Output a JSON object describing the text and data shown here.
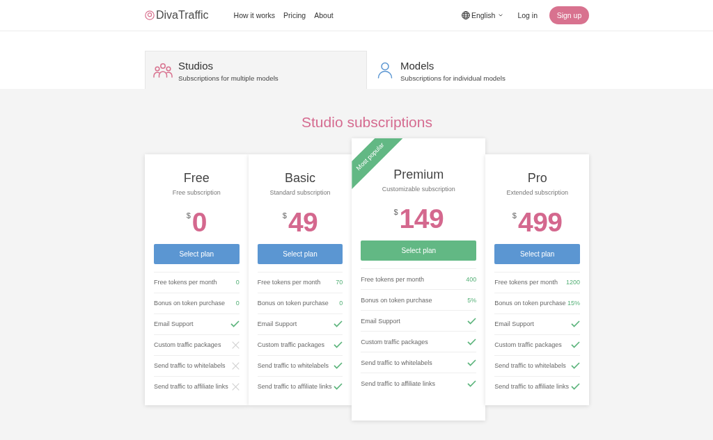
{
  "header": {
    "logo": "DivaTraffic",
    "nav": [
      "How it works",
      "Pricing",
      "About"
    ],
    "language": "English",
    "login": "Log in",
    "signup": "Sign up"
  },
  "tabs": [
    {
      "title": "Studios",
      "subtitle": "Subscriptions for multiple models",
      "selected": true
    },
    {
      "title": "Models",
      "subtitle": "Subscriptions for individual models",
      "selected": false
    }
  ],
  "heading": "Studio subscriptions",
  "plans": [
    {
      "name": "Free",
      "subtitle": "Free subscription",
      "currency": "$",
      "price": "0",
      "button": "Select plan",
      "featured": false,
      "features": [
        {
          "label": "Free tokens per month",
          "kind": "value",
          "value": "0"
        },
        {
          "label": "Bonus on token purchase",
          "kind": "value",
          "value": "0"
        },
        {
          "label": "Email Support",
          "kind": "check",
          "included": true
        },
        {
          "label": "Custom traffic packages",
          "kind": "check",
          "included": false
        },
        {
          "label": "Send traffic to whitelabels",
          "kind": "check",
          "included": false
        },
        {
          "label": "Send traffic to affiliate links",
          "kind": "check",
          "included": false
        }
      ]
    },
    {
      "name": "Basic",
      "subtitle": "Standard subscription",
      "currency": "$",
      "price": "49",
      "button": "Select plan",
      "featured": false,
      "features": [
        {
          "label": "Free tokens per month",
          "kind": "value",
          "value": "70"
        },
        {
          "label": "Bonus on token purchase",
          "kind": "value",
          "value": "0"
        },
        {
          "label": "Email Support",
          "kind": "check",
          "included": true
        },
        {
          "label": "Custom traffic packages",
          "kind": "check",
          "included": true
        },
        {
          "label": "Send traffic to whitelabels",
          "kind": "check",
          "included": true
        },
        {
          "label": "Send traffic to affiliate links",
          "kind": "check",
          "included": true
        }
      ]
    },
    {
      "name": "Premium",
      "subtitle": "Customizable subscription",
      "currency": "$",
      "price": "149",
      "button": "Select plan",
      "featured": true,
      "ribbon": "Most popular",
      "features": [
        {
          "label": "Free tokens per month",
          "kind": "value",
          "value": "400"
        },
        {
          "label": "Bonus on token purchase",
          "kind": "value",
          "value": "5%"
        },
        {
          "label": "Email Support",
          "kind": "check",
          "included": true
        },
        {
          "label": "Custom traffic packages",
          "kind": "check",
          "included": true
        },
        {
          "label": "Send traffic to whitelabels",
          "kind": "check",
          "included": true
        },
        {
          "label": "Send traffic to affiliate links",
          "kind": "check",
          "included": true
        }
      ]
    },
    {
      "name": "Pro",
      "subtitle": "Extended subscription",
      "currency": "$",
      "price": "499",
      "button": "Select plan",
      "featured": false,
      "features": [
        {
          "label": "Free tokens per month",
          "kind": "value",
          "value": "1200"
        },
        {
          "label": "Bonus on token purchase",
          "kind": "value",
          "value": "15%"
        },
        {
          "label": "Email Support",
          "kind": "check",
          "included": true
        },
        {
          "label": "Custom traffic packages",
          "kind": "check",
          "included": true
        },
        {
          "label": "Send traffic to whitelabels",
          "kind": "check",
          "included": true
        },
        {
          "label": "Send traffic to affiliate links",
          "kind": "check",
          "included": true
        }
      ]
    }
  ]
}
